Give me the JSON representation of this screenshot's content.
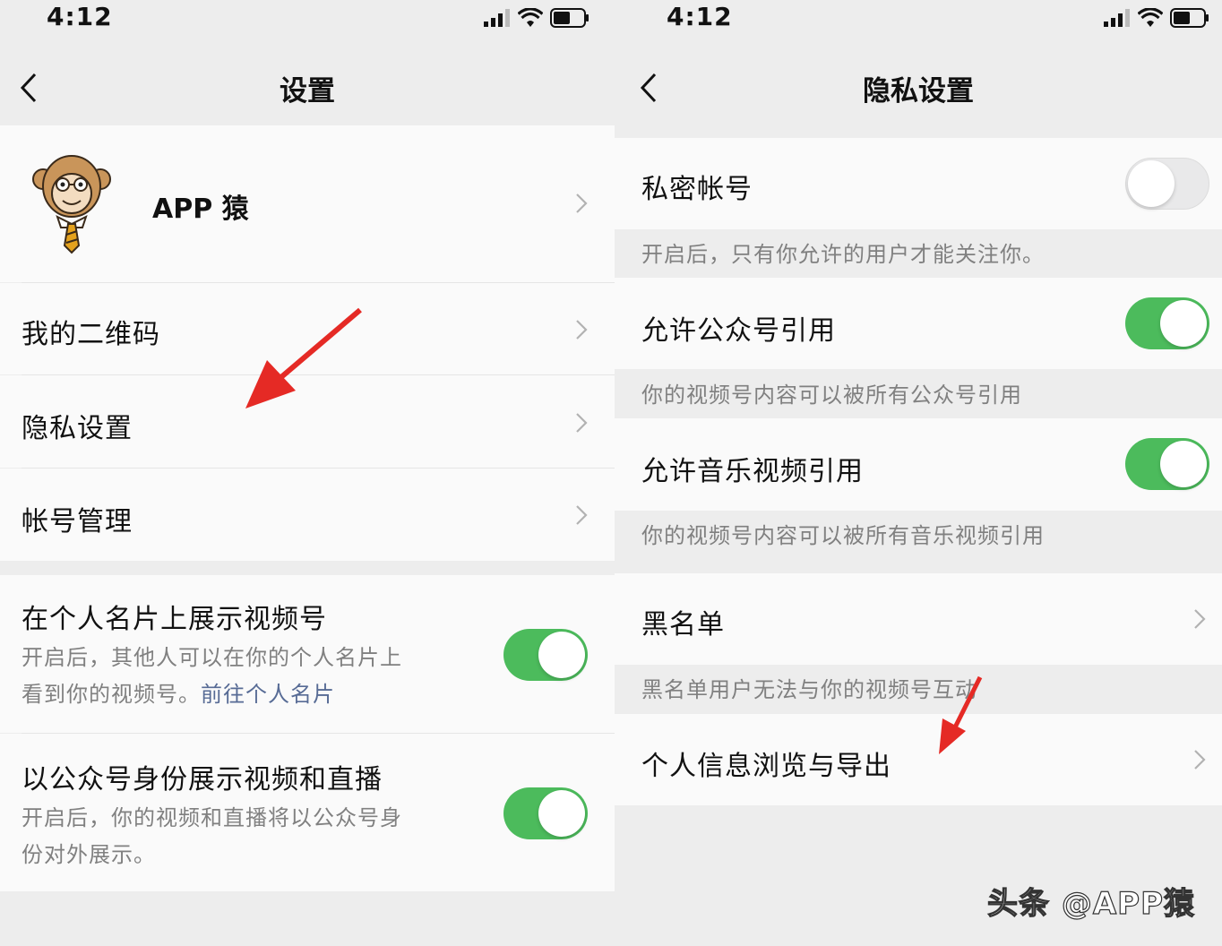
{
  "colors": {
    "accent_green": "#4cbb5c",
    "link_blue": "#576b95",
    "arrow_red": "#e52a25"
  },
  "left": {
    "status": {
      "time": "4:12"
    },
    "nav": {
      "title": "设置",
      "back_icon": "chevron-left-icon"
    },
    "profile": {
      "name": "APP 猿",
      "avatar": "monkey-avatar"
    },
    "menu": [
      {
        "label": "我的二维码"
      },
      {
        "label": "隐私设置"
      },
      {
        "label": "帐号管理"
      }
    ],
    "toggles": [
      {
        "label": "在个人名片上展示视频号",
        "desc_line1": "开启后，其他人可以在你的个人名片上",
        "desc_line2": "看到你的视频号。",
        "desc_link": "前往个人名片",
        "on": true
      },
      {
        "label": "以公众号身份展示视频和直播",
        "desc_line1": "开启后，你的视频和直播将以公众号身",
        "desc_line2": "份对外展示。",
        "on": true
      }
    ]
  },
  "right": {
    "status": {
      "time": "4:12"
    },
    "nav": {
      "title": "隐私设置",
      "back_icon": "chevron-left-icon"
    },
    "toggles": [
      {
        "label": "私密帐号",
        "desc": "开启后，只有你允许的用户才能关注你。",
        "on": false
      },
      {
        "label": "允许公众号引用",
        "desc": "你的视频号内容可以被所有公众号引用",
        "on": true
      },
      {
        "label": "允许音乐视频引用",
        "desc": "你的视频号内容可以被所有音乐视频引用",
        "on": true
      }
    ],
    "blacklist": {
      "label": "黑名单",
      "desc": "黑名单用户无法与你的视频号互动"
    },
    "export": {
      "label": "个人信息浏览与导出"
    }
  },
  "watermark": "头条 @APP猿"
}
